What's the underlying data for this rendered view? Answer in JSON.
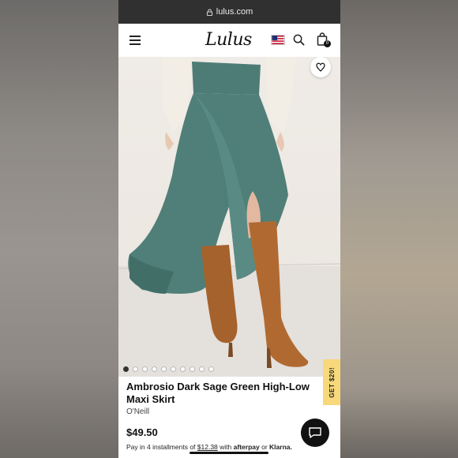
{
  "browser": {
    "url": "lulus.com",
    "lock_icon": "lock-icon"
  },
  "header": {
    "logo": "Lulus",
    "menu_icon": "hamburger-icon",
    "flag_icon": "us-flag-icon",
    "search_icon": "search-icon",
    "bag_icon": "shopping-bag-icon",
    "bag_count": "0"
  },
  "gallery": {
    "image_count": 10,
    "active_index": 0,
    "wishlist_icon": "heart-icon",
    "promo_tab": "GET $20!"
  },
  "product": {
    "title": "Ambrosio Dark Sage Green High-Low Maxi Skirt",
    "brand": "O'Neill",
    "price": "$49.50",
    "installments_prefix": "Pay in 4 installments of",
    "installment_amount": "$12.38",
    "installments_with": "with",
    "afterpay": "afterpay",
    "or": "or",
    "klarna": "Klarna."
  },
  "chat": {
    "icon": "chat-icon"
  },
  "colors": {
    "skirt": "#4f7f78",
    "boots": "#a8652f",
    "sweater": "#f1ece3",
    "promo": "#f7d87a"
  }
}
